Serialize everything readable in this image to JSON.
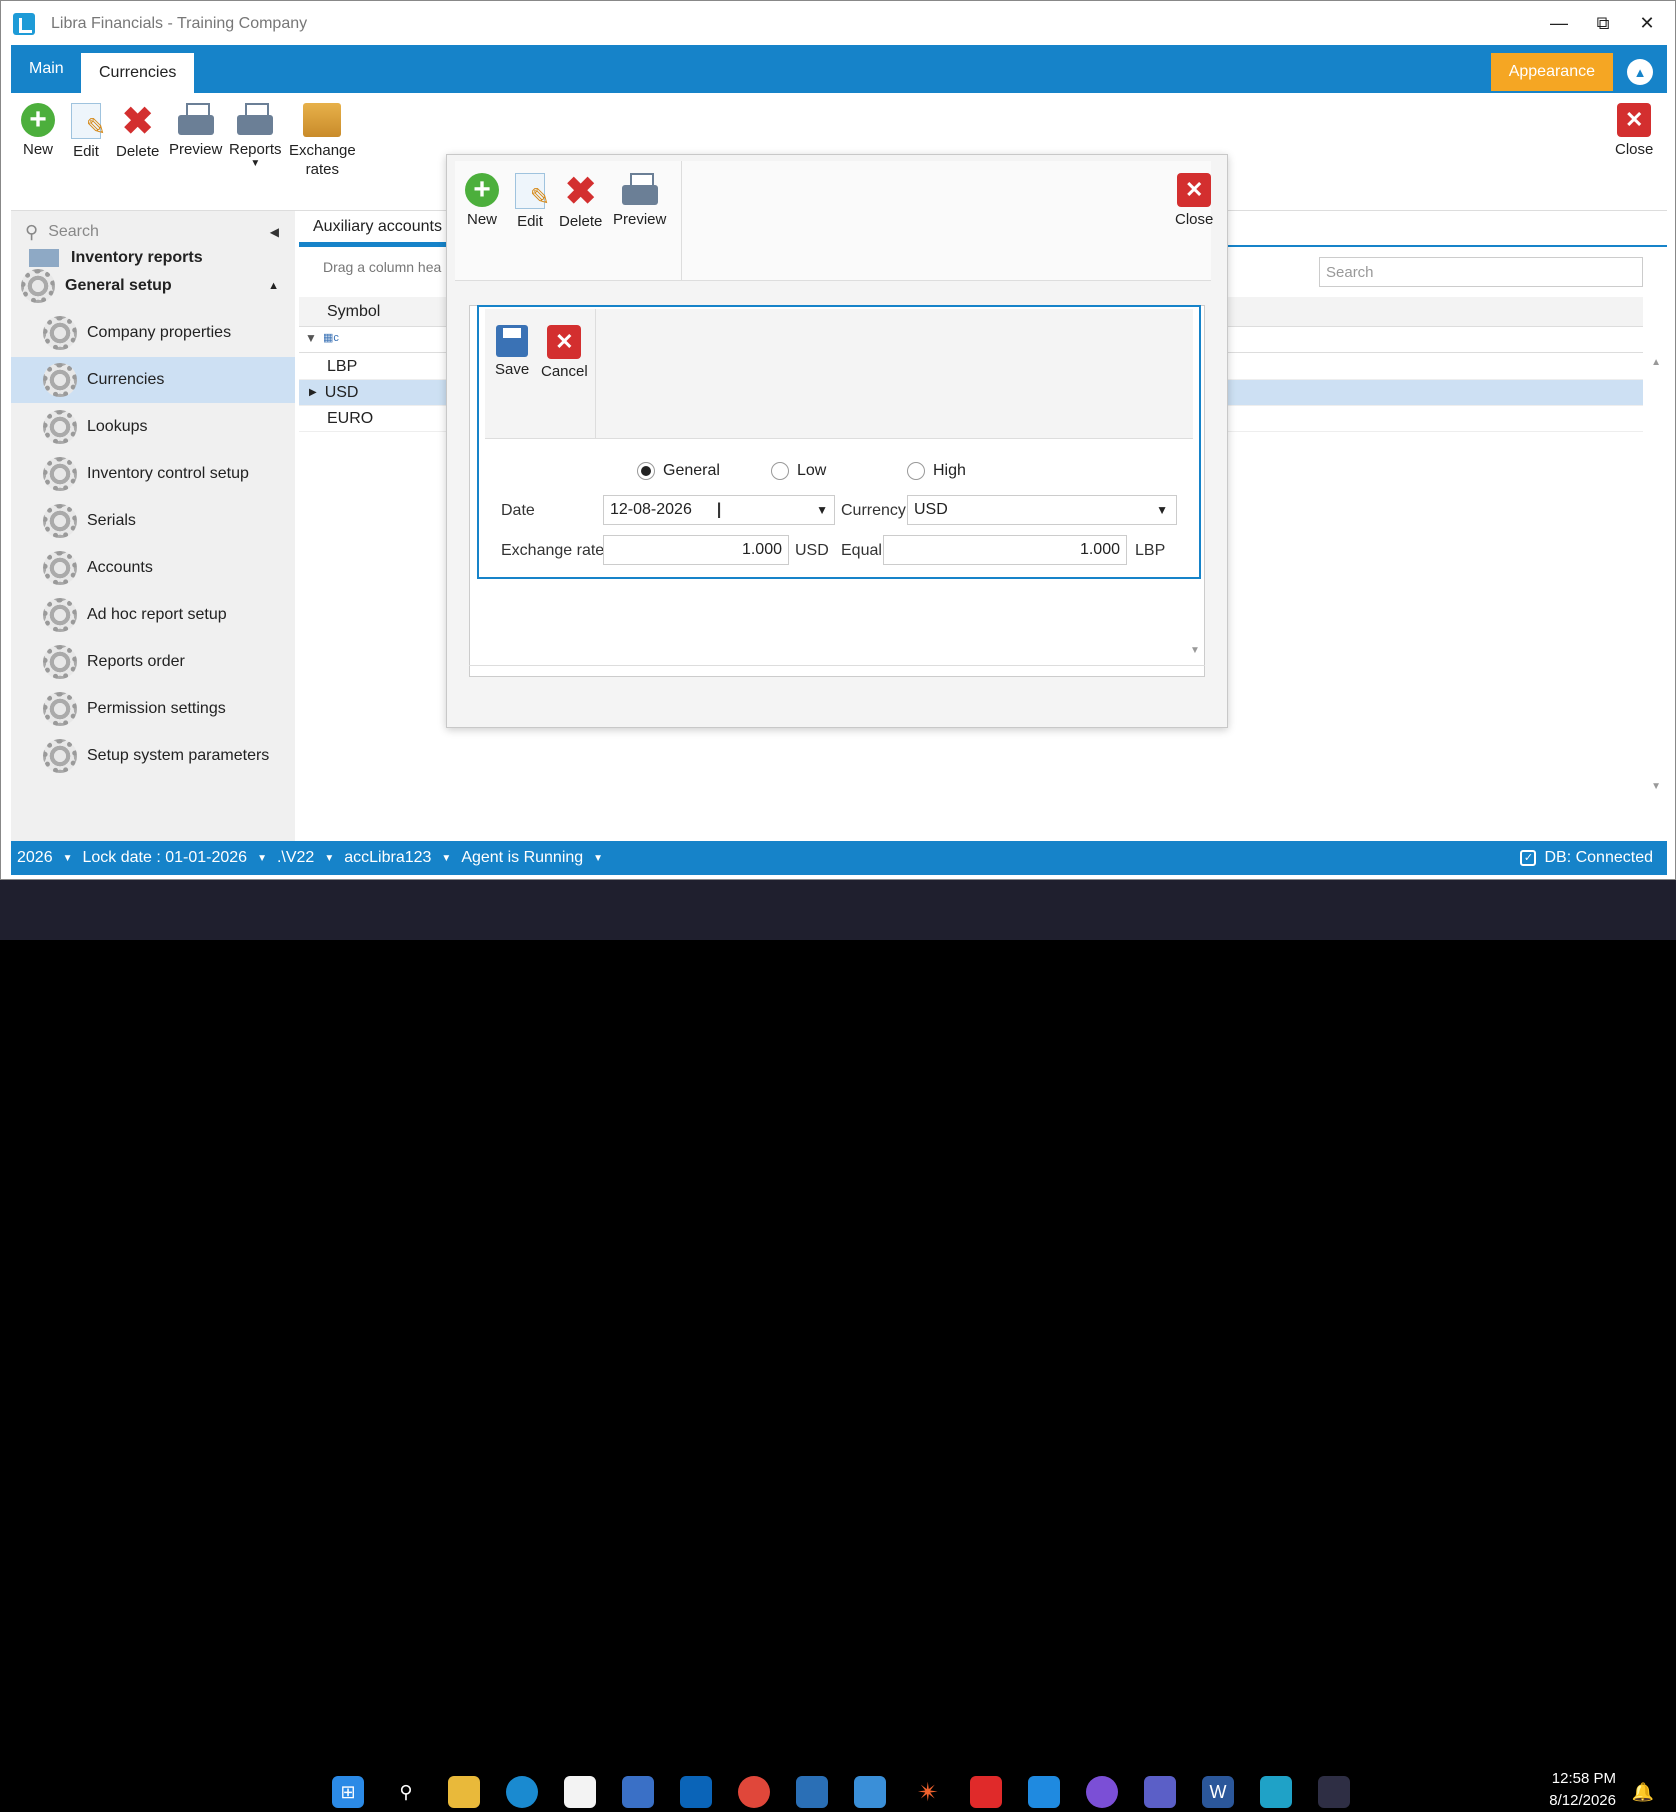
{
  "window": {
    "title": "Libra Financials - Training Company"
  },
  "ribbon": {
    "tabs": [
      "Main",
      "Currencies"
    ],
    "appearance": "Appearance"
  },
  "toolbar": {
    "new": "New",
    "edit": "Edit",
    "delete": "Delete",
    "preview": "Preview",
    "reports": "Reports",
    "exchange_rates": "Exchange\nrates",
    "close": "Close"
  },
  "sidebar": {
    "search_placeholder": "Search",
    "partial_item": "Inventory reports",
    "group": "General setup",
    "items": [
      "Company properties",
      "Currencies",
      "Lookups",
      "Inventory control setup",
      "Serials",
      "Accounts",
      "Ad hoc report setup",
      "Reports order",
      "Permission settings",
      "Setup system parameters"
    ],
    "selected": "Currencies"
  },
  "main": {
    "tab": "Auxiliary accounts",
    "drag_hint": "Drag a column hea",
    "search_placeholder": "Search",
    "grid": {
      "column": "Symbol",
      "rows": [
        "LBP",
        "USD",
        "EURO"
      ],
      "selected_row": "USD"
    }
  },
  "outer_dialog": {
    "new": "New",
    "edit": "Edit",
    "delete": "Delete",
    "preview": "Preview",
    "close": "Close"
  },
  "inner_dialog": {
    "save": "Save",
    "cancel": "Cancel",
    "radios": {
      "general": "General",
      "low": "Low",
      "high": "High",
      "selected": "General"
    },
    "date_label": "Date",
    "date_value": "12-08-2026",
    "currency_label": "Currency",
    "currency_value": "USD",
    "rate_label": "Exchange rate",
    "rate_value": "1.000",
    "rate_unit": "USD",
    "equal_label": "Equal",
    "equal_value": "1.000",
    "equal_unit": "LBP"
  },
  "statusbar": {
    "year": "2026",
    "lock_date": "Lock date : 01-01-2026",
    "version": ".\\V22",
    "user": "accLibra123",
    "agent": "Agent is Running",
    "db": "DB: Connected"
  },
  "taskbar": {
    "time": "12:58 PM",
    "date": "8/12/2026"
  },
  "colors": {
    "accent": "#1683c9",
    "appearance": "#f5a623",
    "selected": "#cde0f3",
    "danger": "#d32f2f"
  }
}
